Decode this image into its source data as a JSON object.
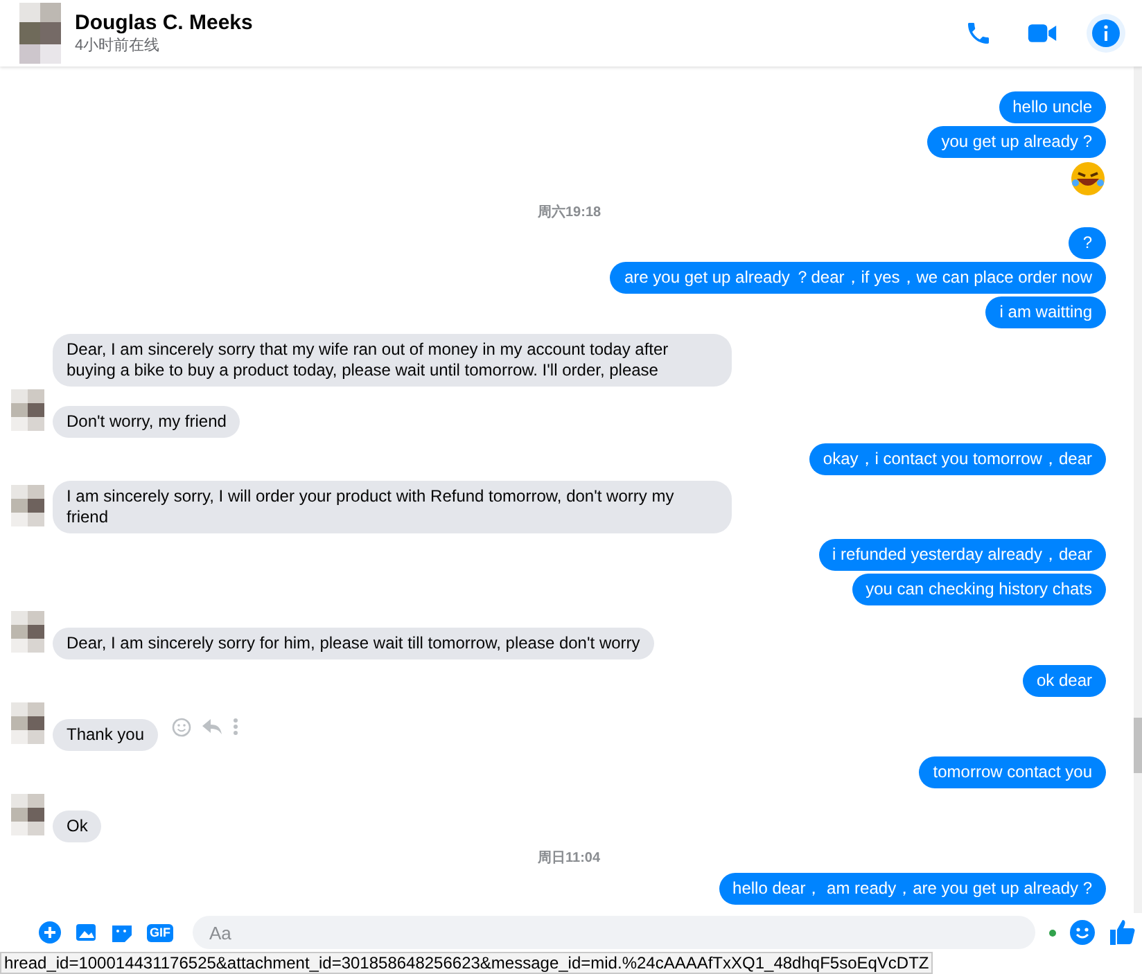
{
  "header": {
    "name": "Douglas C. Meeks",
    "status": "4小时前在线"
  },
  "messages": [
    {
      "kind": "outgoing",
      "text": "hello uncle"
    },
    {
      "kind": "outgoing",
      "text": "you get up already ?"
    },
    {
      "kind": "emoji"
    },
    {
      "kind": "time",
      "text": "周六19:18"
    },
    {
      "kind": "outgoing",
      "text": "?"
    },
    {
      "kind": "outgoing",
      "text": "are you get up already ？dear，if yes，we can place order now"
    },
    {
      "kind": "outgoing",
      "text": "i am waitting"
    },
    {
      "kind": "incoming",
      "text": "Dear, I am sincerely sorry that my wife ran out of money in my account today after buying a bike to buy a product today, please wait until tomorrow.  I'll order, please",
      "avatar": false,
      "actions": false
    },
    {
      "kind": "incoming",
      "text": "Don't worry, my friend",
      "avatar": true,
      "actions": false
    },
    {
      "kind": "outgoing",
      "text": "okay，i contact you tomorrow，dear"
    },
    {
      "kind": "incoming",
      "text": "I am sincerely sorry, I will order your product with Refund tomorrow, don't worry my friend",
      "avatar": true,
      "actions": false
    },
    {
      "kind": "outgoing",
      "text": "i refunded yesterday already，dear"
    },
    {
      "kind": "outgoing",
      "text": "you can checking history chats"
    },
    {
      "kind": "incoming",
      "text": "Dear, I am sincerely sorry for him, please wait till tomorrow, please don't worry",
      "avatar": true,
      "actions": false
    },
    {
      "kind": "outgoing",
      "text": "ok dear"
    },
    {
      "kind": "incoming",
      "text": "Thank you",
      "avatar": true,
      "actions": true
    },
    {
      "kind": "outgoing",
      "text": "tomorrow contact you"
    },
    {
      "kind": "incoming",
      "text": "Ok",
      "avatar": true,
      "actions": false
    },
    {
      "kind": "time",
      "text": "周日11:04"
    },
    {
      "kind": "outgoing",
      "text": "hello dear， am ready，are you get up already ?"
    }
  ],
  "composer": {
    "gif_label": "GIF",
    "placeholder": "Aa"
  },
  "status_bar": {
    "url": "hread_id=100014431176525&attachment_id=301858648256623&message_id=mid.%24cAAAAfTxXQ1_48dhqF5soEqVcDTZ"
  }
}
